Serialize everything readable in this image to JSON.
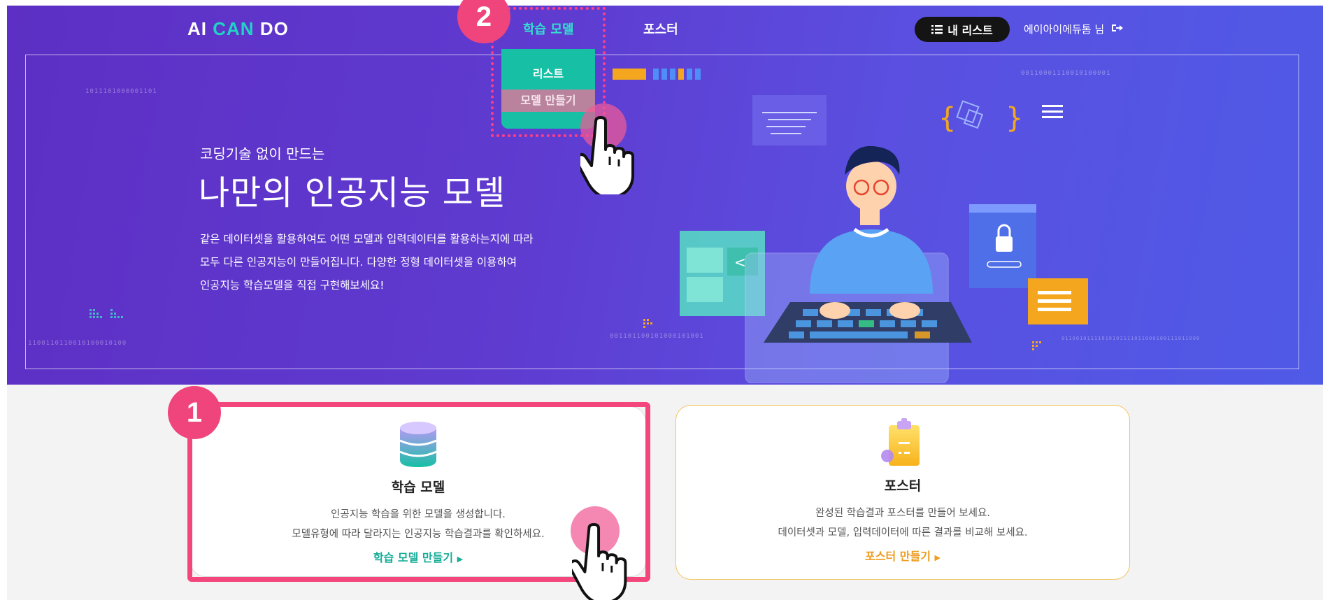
{
  "header": {
    "logo": {
      "part1": "AI",
      "part2": "CAN",
      "part3": "DO"
    },
    "nav": [
      {
        "label": "학습 모델",
        "active": true
      },
      {
        "label": "포스터",
        "active": false
      }
    ],
    "my_list_label": "내 리스트",
    "user_name": "에이아이에듀톰 님"
  },
  "dropdown": {
    "items": [
      {
        "label": "리스트"
      },
      {
        "label": "모델 만들기"
      }
    ]
  },
  "hero": {
    "subtitle": "코딩기술 없이 만드는",
    "title": "나만의 인공지능 모델",
    "description": [
      "같은 데이터셋을 활용하여도 어떤 모델과 입력데이터를 활용하는지에 따라",
      "모두 다른 인공지능이 만들어집니다. 다양한 정형 데이터셋을 이용하여",
      "인공지능 학습모델을 직접 구현해보세요!"
    ],
    "binary": [
      "1011101000001101",
      "1100110110010100010100",
      "00110001110010100001",
      "001101100101000101001",
      "01100101111010101111011000100111011000"
    ]
  },
  "cards": [
    {
      "icon": "database-icon",
      "title": "학습 모델",
      "desc": [
        "인공지능 학습을 위한 모델을 생성합니다.",
        "모델유형에 따라 달라지는 인공지능 학습결과를 확인하세요."
      ],
      "link": "학습 모델 만들기"
    },
    {
      "icon": "clipboard-icon",
      "title": "포스터",
      "desc": [
        "완성된 학습결과 포스터를 만들어 보세요.",
        "데이터셋과 모델, 입력데이터에 따른 결과를 비교해 보세요."
      ],
      "link": "포스터 만들기"
    }
  ],
  "annotations": {
    "step1": "1",
    "step2": "2"
  },
  "colors": {
    "hero_bg": "#5d2fc4",
    "accent_teal": "#17bfa5",
    "accent_orange": "#ee9c1c",
    "highlight_pink": "#f2467d"
  }
}
